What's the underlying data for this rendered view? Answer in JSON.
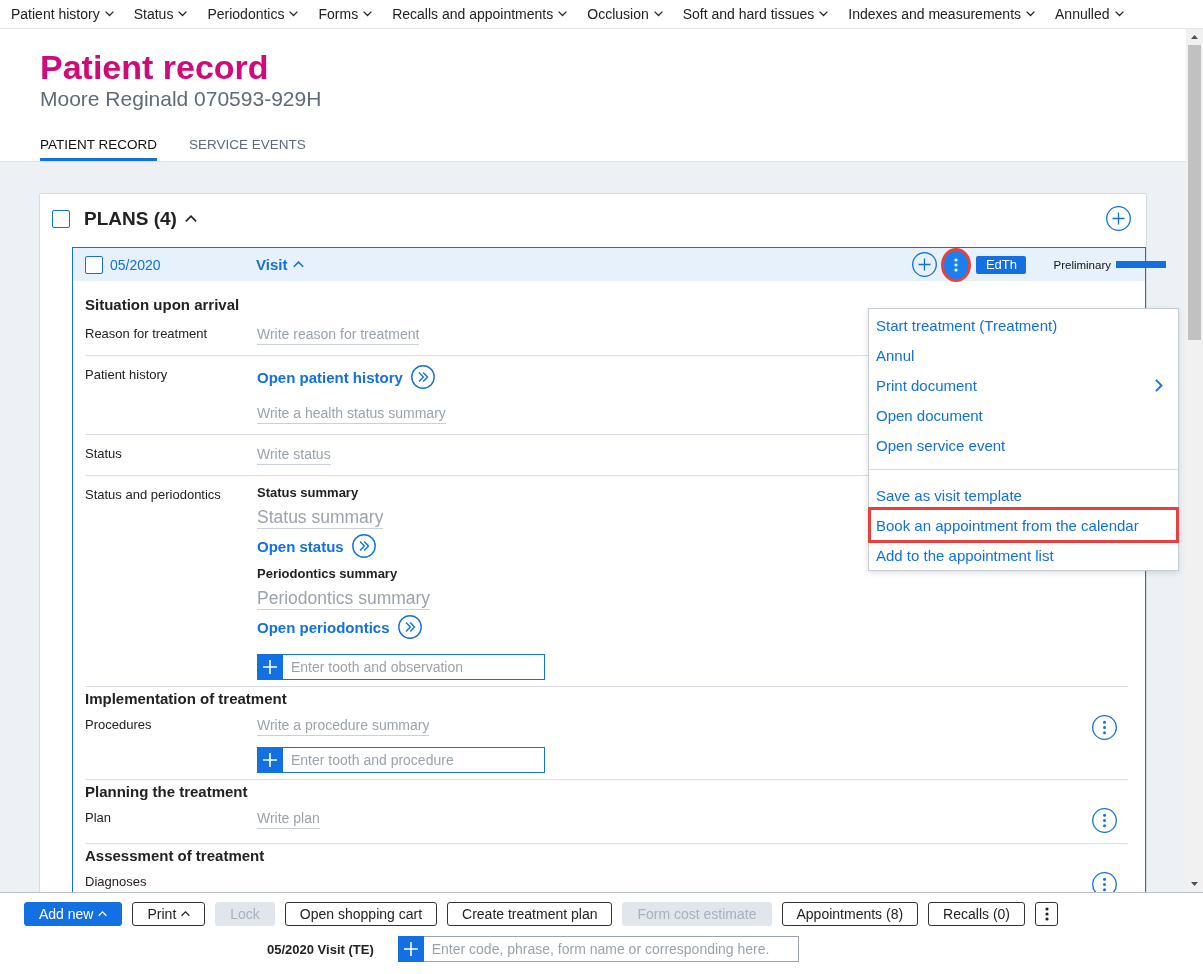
{
  "menu_bar": [
    "Patient history",
    "Status",
    "Periodontics",
    "Forms",
    "Recalls and appointments",
    "Occlusion",
    "Soft and hard tissues",
    "Indexes and measurements",
    "Annulled"
  ],
  "header": {
    "title": "Patient record",
    "subtitle": "Moore Reginald 070593-929H"
  },
  "tabs": [
    {
      "label": "PATIENT RECORD",
      "selected": true
    },
    {
      "label": "SERVICE EVENTS",
      "selected": false
    }
  ],
  "plans": {
    "title": "PLANS (4)",
    "checked": false,
    "expanded": true,
    "plan": {
      "date": "05/2020",
      "checked": false,
      "type": "Visit",
      "expanded": true,
      "more_highlighted": true,
      "badge": "EdTh",
      "status": "Preliminary",
      "sections": [
        {
          "heading": "Situation upon arrival",
          "rows": [
            {
              "label": "Reason for treatment",
              "has_menu": false,
              "items": [
                {
                  "kind": "text_field",
                  "placeholder": "Write reason for treatment"
                }
              ]
            },
            {
              "label": "Patient history",
              "has_menu": false,
              "items": [
                {
                  "kind": "link",
                  "label": "Open patient history"
                },
                {
                  "kind": "text_field",
                  "placeholder": "Write a health status summary"
                }
              ]
            },
            {
              "label": "Status",
              "has_menu": false,
              "items": [
                {
                  "kind": "text_field",
                  "placeholder": "Write status"
                }
              ]
            },
            {
              "label": "Status and periodontics",
              "has_menu": false,
              "items": [
                {
                  "kind": "subheading",
                  "label": "Status summary"
                },
                {
                  "kind": "summary_field",
                  "placeholder": "Status summary"
                },
                {
                  "kind": "link",
                  "label": "Open status"
                },
                {
                  "kind": "subheading",
                  "label": "Periodontics summary"
                },
                {
                  "kind": "summary_field",
                  "placeholder": "Periodontics summary"
                },
                {
                  "kind": "link",
                  "label": "Open periodontics"
                },
                {
                  "kind": "entry_field",
                  "placeholder": "Enter tooth and observation"
                }
              ]
            }
          ]
        },
        {
          "heading": "Implementation of treatment",
          "rows": [
            {
              "label": "Procedures",
              "has_menu": true,
              "items": [
                {
                  "kind": "text_field",
                  "placeholder": "Write a procedure summary"
                },
                {
                  "kind": "entry_field",
                  "placeholder": "Enter tooth and procedure"
                }
              ]
            }
          ]
        },
        {
          "heading": "Planning the treatment",
          "rows": [
            {
              "label": "Plan",
              "has_menu": true,
              "items": [
                {
                  "kind": "text_field",
                  "placeholder": "Write plan"
                }
              ]
            }
          ]
        },
        {
          "heading": "Assessment of treatment",
          "rows": [
            {
              "label": "Diagnoses",
              "has_menu": true
            }
          ]
        }
      ]
    }
  },
  "context_menu": {
    "groups": [
      [
        {
          "label": "Start treatment (Treatment)",
          "highlighted": false,
          "submenu": false
        },
        {
          "label": "Annul",
          "highlighted": false,
          "submenu": false
        },
        {
          "label": "Print document",
          "highlighted": false,
          "submenu": true
        },
        {
          "label": "Open document",
          "highlighted": false,
          "submenu": false
        },
        {
          "label": "Open service event",
          "highlighted": false,
          "submenu": false
        }
      ],
      [
        {
          "label": "Save as visit template",
          "highlighted": false,
          "submenu": false
        },
        {
          "label": "Book an appointment from the calendar",
          "highlighted": true,
          "submenu": false
        },
        {
          "label": "Add to the appointment list",
          "highlighted": false,
          "submenu": false
        }
      ]
    ]
  },
  "toolbar": {
    "buttons": [
      {
        "label": "Add new",
        "kind": "primary",
        "caret": true,
        "disabled": false
      },
      {
        "label": "Print",
        "kind": "secondary",
        "caret": true,
        "disabled": false
      },
      {
        "label": "Lock",
        "kind": "secondary",
        "caret": false,
        "disabled": true
      },
      {
        "label": "Open shopping cart",
        "kind": "secondary",
        "caret": false,
        "disabled": false
      },
      {
        "label": "Create treatment plan",
        "kind": "secondary",
        "caret": false,
        "disabled": false
      },
      {
        "label": "Form cost estimate",
        "kind": "secondary",
        "caret": false,
        "disabled": true
      },
      {
        "label": "Appointments (8)",
        "kind": "secondary",
        "caret": false,
        "disabled": false
      },
      {
        "label": "Recalls (0)",
        "kind": "secondary",
        "caret": false,
        "disabled": false
      }
    ],
    "context_label": "05/2020 Visit (TE)",
    "command_field": {
      "placeholder": "Enter code, phrase, form name or corresponding here."
    }
  }
}
